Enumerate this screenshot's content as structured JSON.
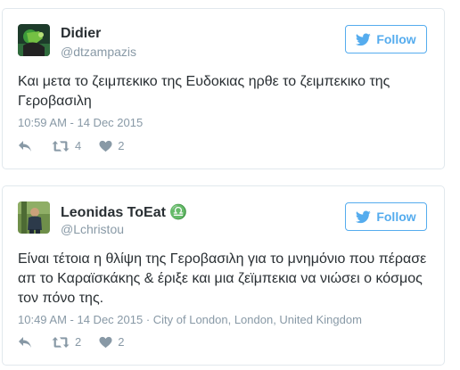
{
  "tweets": [
    {
      "name": "Didier",
      "handle": "@dtzampazis",
      "follow_label": "Follow",
      "text": "Και μετα το ζειμπεκικο της Ευδοκιας ηρθε το ζειμπεκικο της Γεροβασιλη",
      "timestamp": "10:59 AM - 14 Dec 2015",
      "location": "",
      "retweets": "4",
      "likes": "2",
      "icons": [
        "reply-icon",
        "retweet-icon",
        "like-icon"
      ]
    },
    {
      "name": "Leonidas ToEat",
      "name_symbol": "♎",
      "handle": "@Lchristou",
      "follow_label": "Follow",
      "text": "Είναι τέτοια η θλίψη της Γεροβασιλη για το μνημόνιο  που πέρασε απ το Καραϊσκάκης & έριξε και μια ζεϊμπεκια να νιώσει ο κόσμος τον πόνο της.",
      "timestamp": "10:49 AM - 14 Dec 2015",
      "location": " · City of London, London, United Kingdom",
      "retweets": "2",
      "likes": "2",
      "icons": [
        "reply-icon",
        "retweet-icon",
        "like-icon"
      ]
    }
  ],
  "colors": {
    "twitter_blue": "#55acee",
    "text": "#292f33",
    "muted": "#8899a6",
    "border": "#e1e8ed"
  }
}
